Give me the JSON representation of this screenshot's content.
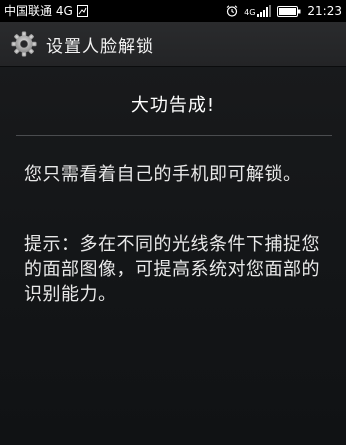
{
  "status_bar": {
    "carrier": "中国联通 4G",
    "network_type": "4G",
    "time": "21:23"
  },
  "app_bar": {
    "title": "设置人脸解锁",
    "icon": "gear-icon"
  },
  "main": {
    "headline": "大功告成!",
    "message": "您只需看着自己的手机即可解锁。",
    "tip": "提示：多在不同的光线条件下捕捉您的面部图像，可提高系统对您面部的识别能力。"
  },
  "colors": {
    "status_bar_bg": "#000000",
    "action_bar_bg": "#262729",
    "screen_bg": "#151719",
    "text": "#ffffff"
  }
}
